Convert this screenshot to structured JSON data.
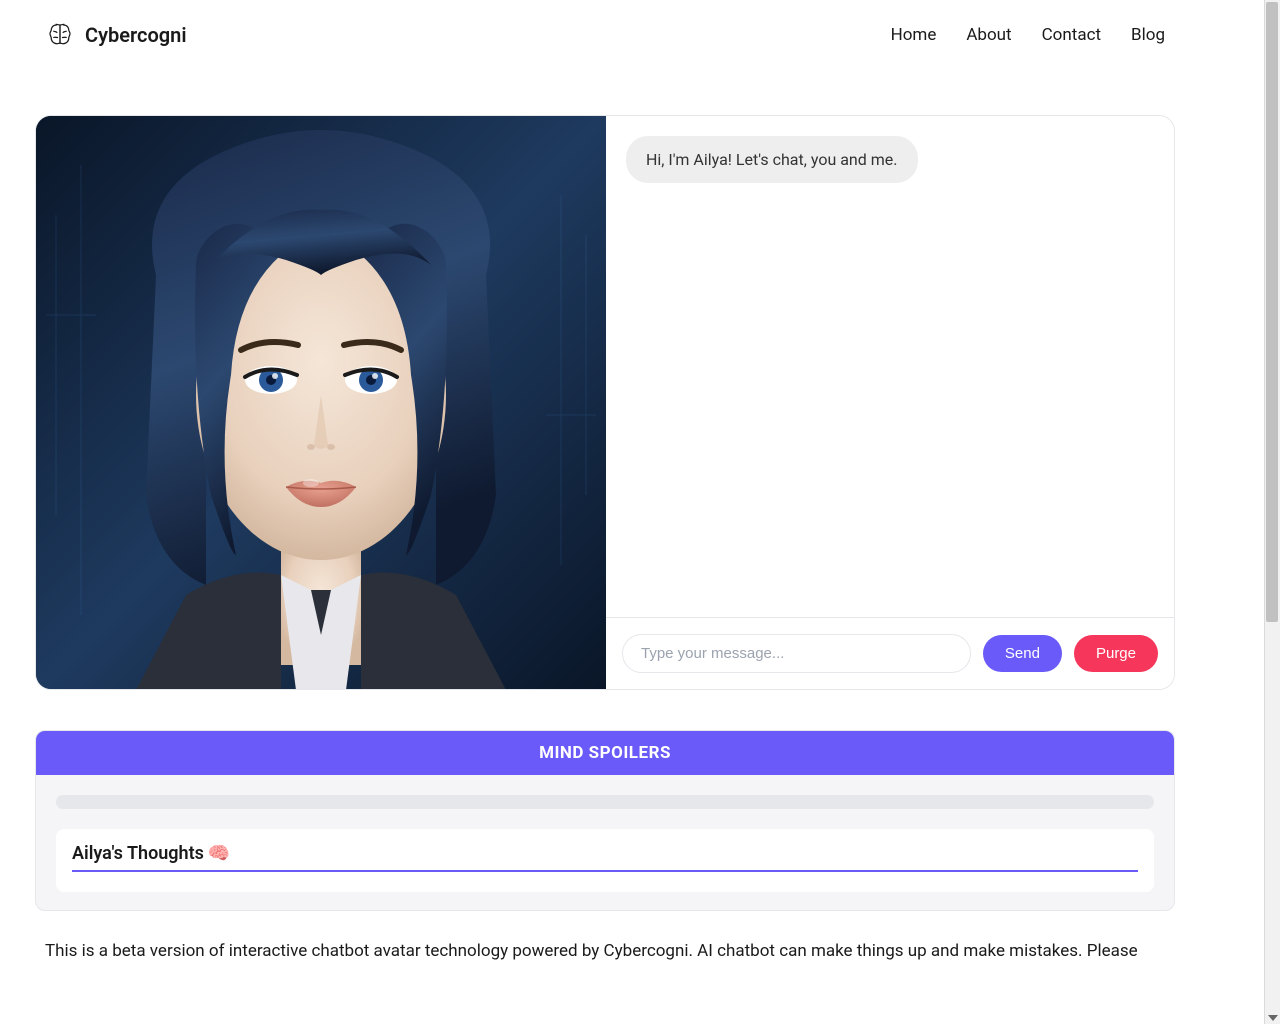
{
  "header": {
    "brand": "Cybercogni",
    "nav": {
      "home": "Home",
      "about": "About",
      "contact": "Contact",
      "blog": "Blog"
    }
  },
  "chat": {
    "greeting": "Hi, I'm Ailya! Let's chat, you and me.",
    "input_placeholder": "Type your message...",
    "send_label": "Send",
    "purge_label": "Purge"
  },
  "spoilers": {
    "header": "MIND SPOILERS",
    "thoughts_title": "Ailya's Thoughts ",
    "thoughts_emoji": "🧠"
  },
  "disclaimer": "This is a beta version of interactive chatbot avatar technology powered by Cybercogni. AI chatbot can make things up and make mistakes. Please"
}
